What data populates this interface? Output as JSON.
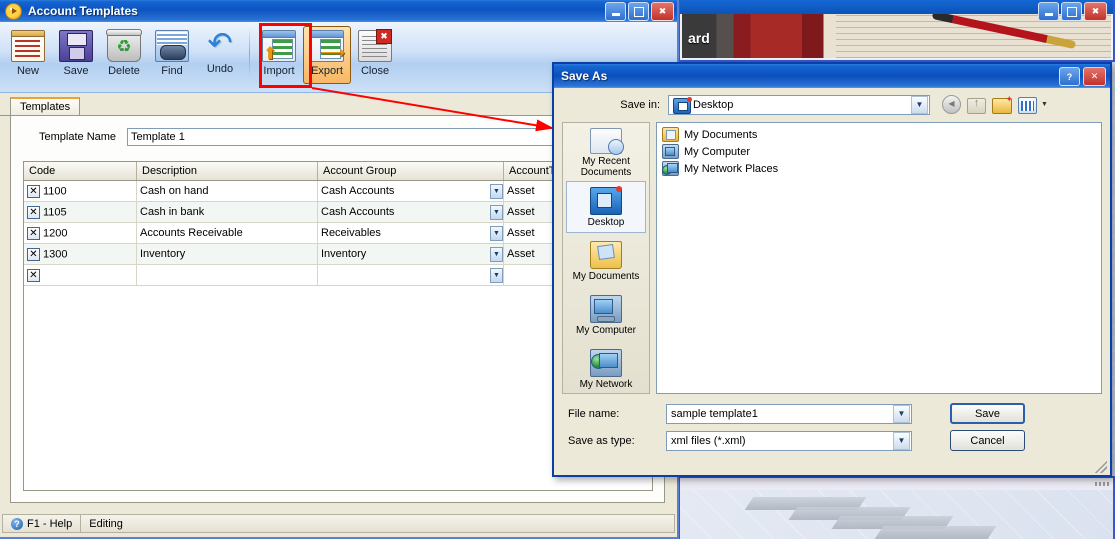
{
  "desktop": {
    "bg_window_top_label": "ard",
    "bg_window_bottom_label": ""
  },
  "main_window": {
    "title": "Account Templates",
    "title_icon": "play-circle-icon",
    "window_buttons": {
      "minimize": "minimize-icon",
      "maximize": "maximize-icon",
      "close": "close-icon"
    },
    "toolbar": [
      {
        "label": "New",
        "icon": "new-document-icon",
        "active": false
      },
      {
        "label": "Save",
        "icon": "floppy-disk-icon",
        "active": false
      },
      {
        "label": "Delete",
        "icon": "trash-recycle-icon",
        "active": false
      },
      {
        "label": "Find",
        "icon": "binoculars-icon",
        "active": false
      },
      {
        "label": "Undo",
        "icon": "undo-arrow-icon",
        "active": false
      },
      {
        "label": "Import",
        "icon": "import-grid-icon",
        "active": false
      },
      {
        "label": "Export",
        "icon": "export-grid-icon",
        "active": true
      },
      {
        "label": "Close",
        "icon": "close-window-icon",
        "active": false
      }
    ],
    "tabs": [
      {
        "label": "Templates",
        "selected": true
      }
    ],
    "template_name": {
      "label": "Template Name",
      "value": "Template 1"
    },
    "grid": {
      "columns": [
        "Code",
        "Description",
        "Account Group",
        "AccountType"
      ],
      "rows": [
        {
          "delete": "✕",
          "code": "1100",
          "description": "Cash on hand",
          "account_group": "Cash Accounts",
          "account_type": "Asset"
        },
        {
          "delete": "✕",
          "code": "1105",
          "description": "Cash in bank",
          "account_group": "Cash Accounts",
          "account_type": "Asset"
        },
        {
          "delete": "✕",
          "code": "1200",
          "description": "Accounts Receivable",
          "account_group": "Receivables",
          "account_type": "Asset"
        },
        {
          "delete": "✕",
          "code": "1300",
          "description": "Inventory",
          "account_group": "Inventory",
          "account_type": "Asset"
        },
        {
          "delete": "✕",
          "code": "",
          "description": "",
          "account_group": "",
          "account_type": ""
        }
      ]
    },
    "status_bar": {
      "help": "F1 - Help",
      "help_icon": "question-circle-icon",
      "state": "Editing"
    }
  },
  "save_as_dialog": {
    "title": "Save As",
    "help_button": "?",
    "close_button": "✕",
    "save_in": {
      "label": "Save in:",
      "value": "Desktop",
      "icon": "desktop-folder-icon"
    },
    "nav_icons": [
      {
        "name": "back-icon"
      },
      {
        "name": "up-one-level-icon"
      },
      {
        "name": "new-folder-icon"
      },
      {
        "name": "views-icon"
      }
    ],
    "places": [
      {
        "label": "My Recent\nDocuments",
        "icon": "recent-documents-icon",
        "selected": false
      },
      {
        "label": "Desktop",
        "icon": "desktop-icon",
        "selected": true
      },
      {
        "label": "My Documents",
        "icon": "my-documents-icon",
        "selected": false
      },
      {
        "label": "My Computer",
        "icon": "my-computer-icon",
        "selected": false
      },
      {
        "label": "My Network",
        "icon": "my-network-icon",
        "selected": false
      }
    ],
    "file_list": [
      {
        "label": "My Documents",
        "icon": "folder-documents-icon"
      },
      {
        "label": "My Computer",
        "icon": "computer-icon"
      },
      {
        "label": "My Network Places",
        "icon": "network-icon"
      }
    ],
    "file_name": {
      "label": "File name:",
      "value": "sample template1"
    },
    "save_as_type": {
      "label": "Save as type:",
      "value": "xml files (*.xml)"
    },
    "buttons": {
      "save": "Save",
      "cancel": "Cancel"
    }
  },
  "annotation": {
    "highlight_target": "Export",
    "color": "#ff0000"
  }
}
